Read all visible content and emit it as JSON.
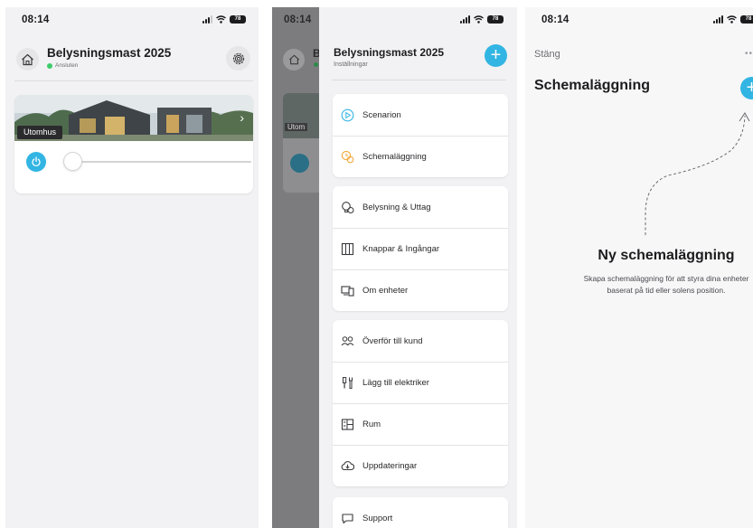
{
  "colors": {
    "accent": "#32b5e3",
    "connected": "#3ecb6a",
    "background": "#f2f2f4",
    "card": "#ffffff"
  },
  "screen_home": {
    "status_time": "08:14",
    "battery": "78",
    "icons": [
      "home-icon",
      "gear-icon",
      "power-icon",
      "chevron-right-icon"
    ],
    "title": "Belysningsmast 2025",
    "connection_status": "Ansluten",
    "device": {
      "name": "Utomhus",
      "brightness": 0
    }
  },
  "screen_menu": {
    "status_time": "08:14",
    "battery": "78",
    "title": "Belysningsmast 2025",
    "subtitle": "Inställningar",
    "obscured": {
      "title_initial": "B",
      "device_name": "Utom"
    },
    "groups": [
      {
        "items": [
          {
            "label": "Scenarion",
            "icon": "play-circle-icon"
          },
          {
            "label": "Schemaläggning",
            "icon": "schedule-icon"
          }
        ]
      },
      {
        "items": [
          {
            "label": "Belysning & Uttag",
            "icon": "lightbulb-icon"
          },
          {
            "label": "Knappar & Ingångar",
            "icon": "button-panel-icon"
          },
          {
            "label": "Om enheter",
            "icon": "devices-icon"
          }
        ]
      },
      {
        "items": [
          {
            "label": "Överför till kund",
            "icon": "transfer-users-icon"
          },
          {
            "label": "Lägg till elektriker",
            "icon": "tools-icon"
          },
          {
            "label": "Rum",
            "icon": "rooms-icon"
          },
          {
            "label": "Uppdateringar",
            "icon": "cloud-download-icon"
          }
        ]
      },
      {
        "items": [
          {
            "label": "Support",
            "icon": "chat-bubble-icon"
          }
        ]
      }
    ]
  },
  "screen_schedule": {
    "status_time": "08:14",
    "battery": "78",
    "close_label": "Stäng",
    "more": "••",
    "title": "Schemaläggning",
    "empty_title": "Ny schemaläggning",
    "empty_description_line1": "Skapa schemaläggning för att styra dina enheter",
    "empty_description_line2": "baserat på tid eller solens position."
  }
}
